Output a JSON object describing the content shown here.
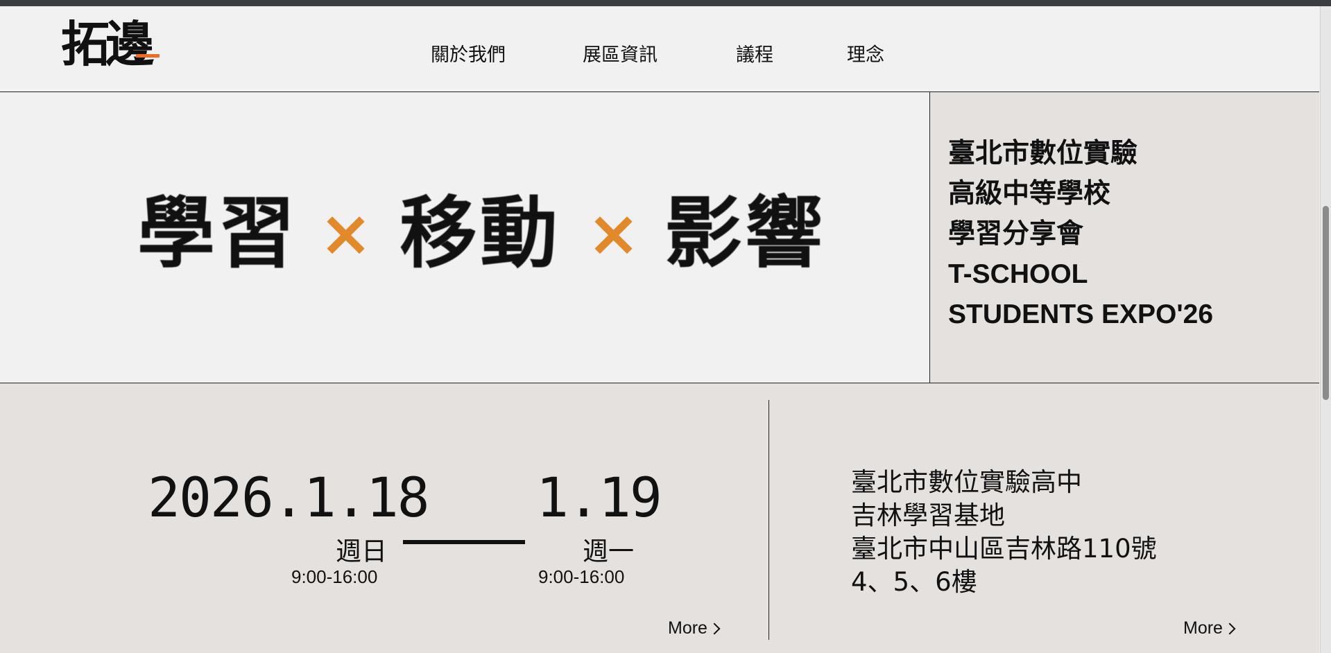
{
  "header": {
    "logo": "拓邊",
    "nav": [
      {
        "label": "關於我們"
      },
      {
        "label": "展區資訊"
      },
      {
        "label": "議程"
      },
      {
        "label": "理念"
      }
    ]
  },
  "hero": {
    "slogan": {
      "word1": "學習",
      "sep1": "×",
      "word2": "移動",
      "sep2": "×",
      "word3": "影響"
    },
    "expo_lines": [
      "臺北市數位實驗",
      "高級中等學校",
      "學習分享會",
      "T-SCHOOL",
      "STUDENTS EXPO'26"
    ]
  },
  "schedule": {
    "start_date": "2026.1.18",
    "end_date": "1.19",
    "start_weekday": "週日",
    "end_weekday": "週一",
    "start_time": "9:00-16:00",
    "end_time": "9:00-16:00",
    "more_label": "More"
  },
  "location": {
    "lines": [
      "臺北市數位實驗高中",
      "吉林學習基地",
      "臺北市中山區吉林路110號",
      "4、5、6樓"
    ],
    "more_label": "More"
  },
  "colors": {
    "accent": "#e28a2b",
    "logo_accent": "#f26a21",
    "panel": "#e4e1df",
    "background": "#f1f1f1"
  }
}
